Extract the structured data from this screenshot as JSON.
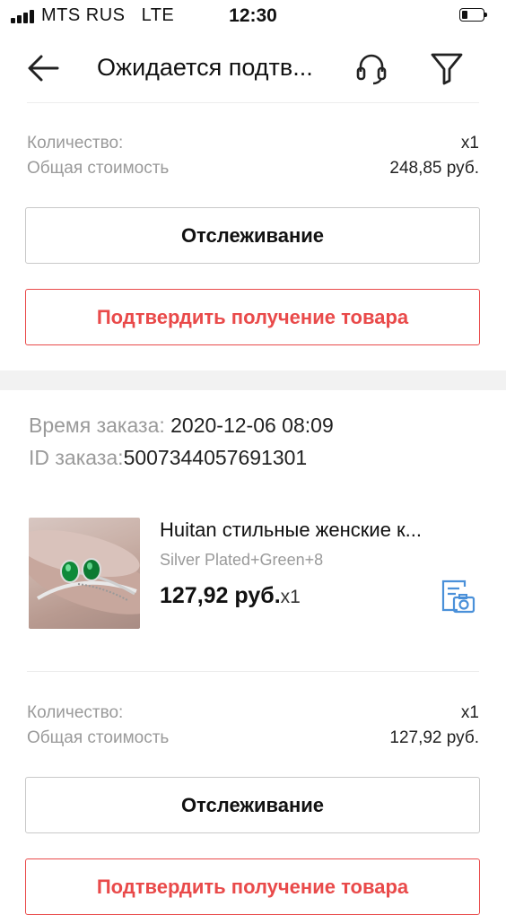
{
  "status_bar": {
    "carrier": "MTS RUS",
    "network": "LTE",
    "time": "12:30"
  },
  "header": {
    "title": "Ожидается подтв...",
    "icons": [
      "back-arrow-icon",
      "support-headset-icon",
      "filter-icon"
    ]
  },
  "order1": {
    "quantity_label": "Количество:",
    "quantity_value": "x1",
    "total_label": "Общая стоимость",
    "total_value": "248,85 руб.",
    "track_button": "Отслеживание",
    "confirm_button": "Подтвердить получение товара"
  },
  "order2": {
    "time_label": "Время заказа:",
    "time_value": "2020-12-06 08:09",
    "id_label": "ID заказа:",
    "id_value": "5007344057691301",
    "product": {
      "title": "Huitan стильные женские к...",
      "variant": "Silver Plated+Green+8",
      "price": "127,92 руб.",
      "qty": "x1"
    },
    "quantity_label": "Количество:",
    "quantity_value": "x1",
    "total_label": "Общая стоимость",
    "total_value": "127,92 руб.",
    "track_button": "Отслеживание",
    "confirm_button": "Подтвердить получение товара"
  },
  "colors": {
    "accent_red": "#e94a4a",
    "icon_blue": "#4a90d9",
    "muted_text": "#9a9a9a",
    "divider_band": "#f2f2f2"
  }
}
